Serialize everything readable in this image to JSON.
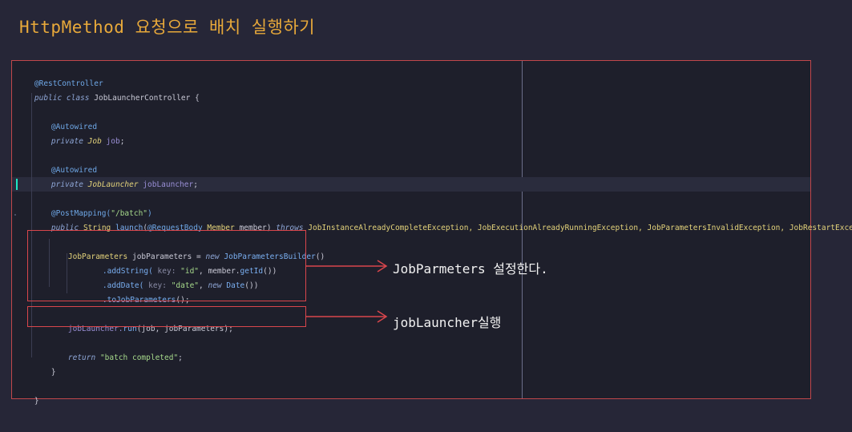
{
  "slide": {
    "title": "HttpMethod 요청으로 배치 실행하기"
  },
  "code": {
    "l1": "@RestController",
    "l2_kw": "public class ",
    "l2_name": "JobLauncherController",
    "l2_tail": " {",
    "autowired": "@Autowired",
    "private_kw": "private ",
    "job_type": "Job",
    "job_var": " job",
    "semi": ";",
    "launcher_type": "JobLauncher",
    "launcher_var": " jobLauncher",
    "postmapping_ann": "@PostMapping(",
    "postmapping_str": "\"/batch\"",
    "postmapping_close": ")",
    "sig_public": "public ",
    "sig_string": "String ",
    "sig_launch": "launch",
    "sig_open": "(",
    "sig_reqbody": "@RequestBody ",
    "sig_member": "Member ",
    "sig_param": "member",
    "sig_close": ") ",
    "sig_throws": "throws ",
    "sig_ex": "JobInstanceAlreadyCompleteException, JobExecutionAlreadyRunningException, JobParametersInvalidException, JobRestartException {",
    "jp_type": "JobParameters ",
    "jp_var": "jobParameters = ",
    "jp_new": "new ",
    "jp_builder": "JobParametersBuilder",
    "jp_paren": "()",
    "add_string_fn": ".addString(",
    "hint_key": " key: ",
    "add_string_key": "\"id\"",
    "add_string_mid": ", member.",
    "add_string_get": "getId",
    "add_string_end": "())",
    "add_date_fn": ".addDate(",
    "add_date_key": "\"date\"",
    "add_date_mid": ", ",
    "add_date_new": "new ",
    "add_date_cls": "Date",
    "add_date_end": "())",
    "to_jp": ".toJobParameters",
    "to_jp_end": "();",
    "run_var": "jobLauncher.",
    "run_fn": "run",
    "run_args": "(job, jobParameters);",
    "return_kw": "return ",
    "return_str": "\"batch completed\"",
    "inner_brace": "}",
    "outer_brace": "}"
  },
  "notes": {
    "params": "JobParmeters 설정한다.",
    "run": "jobLauncher실행"
  },
  "colors": {
    "background": "#262637",
    "editor": "#1e1f2b",
    "frame": "#c0474b",
    "title": "#e8a93a",
    "highlight": "#d9464c"
  }
}
